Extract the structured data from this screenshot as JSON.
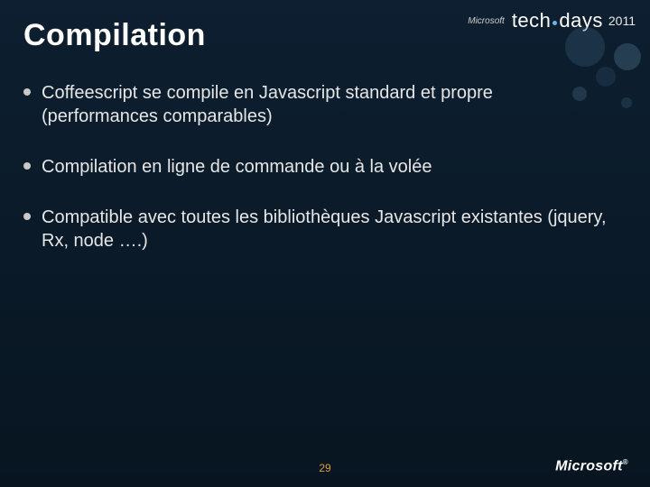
{
  "title": "Compilation",
  "bullets": [
    "Coffeescript se compile en Javascript standard et propre (performances comparables)",
    "Compilation en ligne de commande ou à la volée",
    "Compatible avec toutes les bibliothèques Javascript existantes (jquery, Rx, node ….)"
  ],
  "branding": {
    "vendor_small": "Microsoft",
    "event_word_left": "tech",
    "event_word_right": "days",
    "year": "2011",
    "footer_vendor": "Microsoft"
  },
  "page_number": "29",
  "colors": {
    "background_top": "#0d1f30",
    "background_bottom": "#081521",
    "accent": "#d9a03a",
    "bubble": "#6fb4e8"
  }
}
